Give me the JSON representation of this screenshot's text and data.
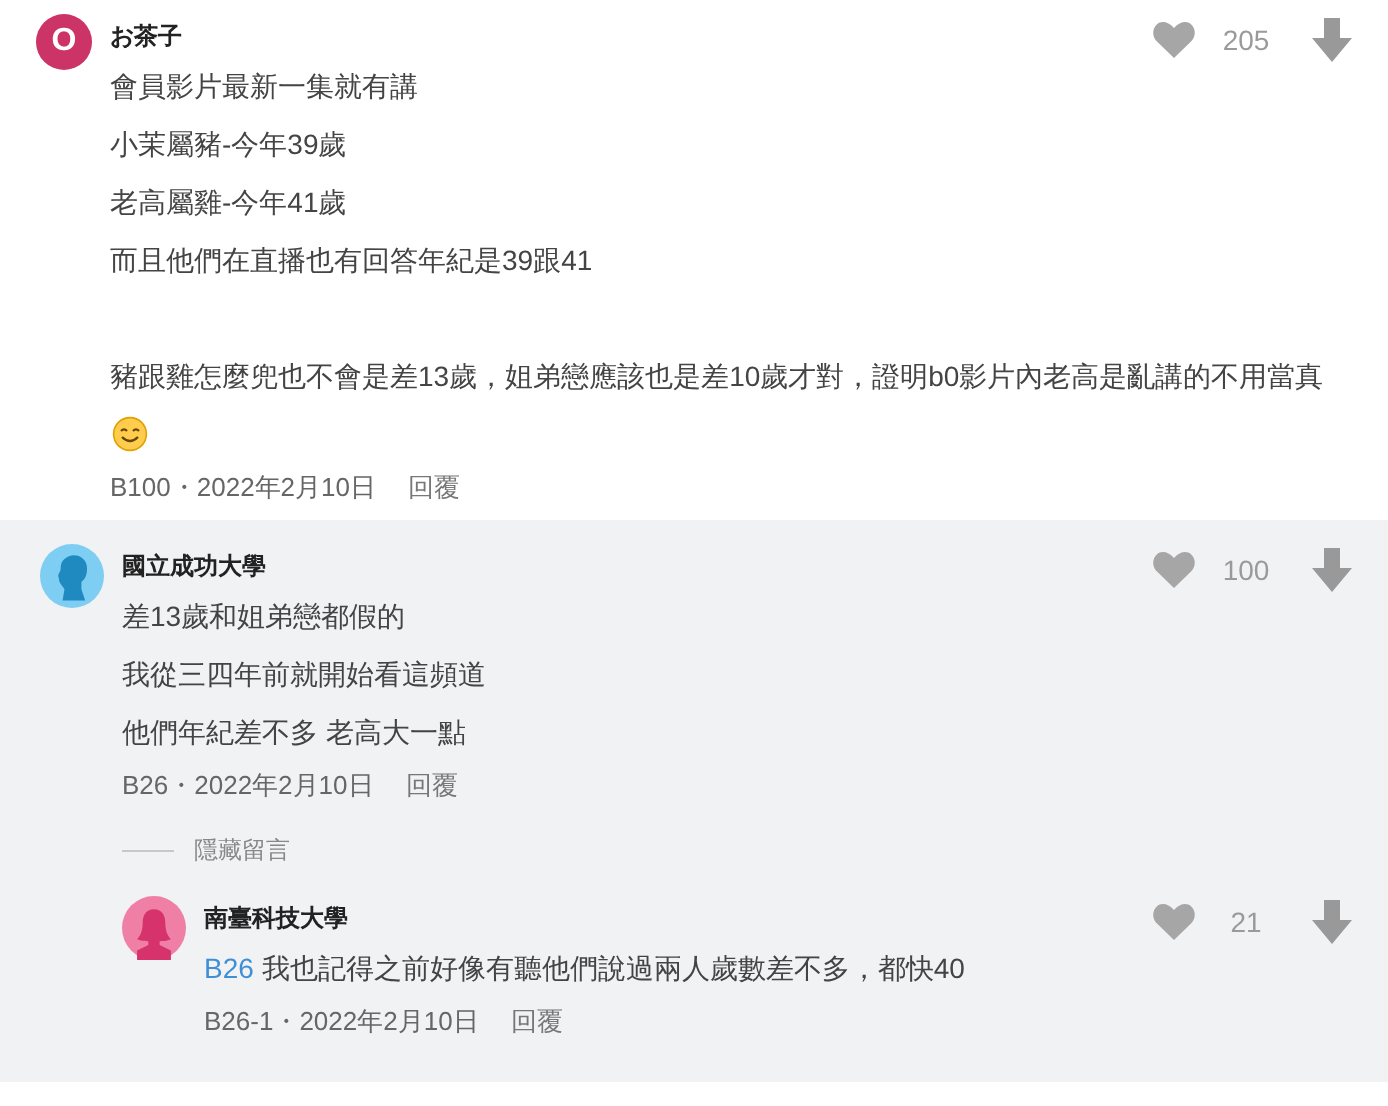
{
  "comments": [
    {
      "author": "お茶子",
      "highlighted": false,
      "avatar": {
        "kind": "letter",
        "letter": "O",
        "color": "#cc3366"
      },
      "paragraphs": [
        [
          "會員影片最新一集就有講",
          "小茉屬豬-今年39歲",
          "老高屬雞-今年41歲",
          "而且他們在直播也有回答年紀是39跟41"
        ],
        [
          "豬跟雞怎麼兜也不會是差13歲，姐弟戀應該也是差10歲才對，證明b0影片內老高是亂講的不用當真"
        ]
      ],
      "smile_emoji": true,
      "likes": "205",
      "floor": "B100",
      "separator": "・",
      "date": "2022年2月10日",
      "reply_label": "回覆"
    },
    {
      "author": "國立成功大學",
      "highlighted": true,
      "avatar": {
        "kind": "male",
        "color": "#7ecdf2"
      },
      "paragraphs": [
        [
          "差13歲和姐弟戀都假的",
          "我從三四年前就開始看這頻道",
          "他們年紀差不多 老高大一點"
        ]
      ],
      "likes": "100",
      "floor": "B26",
      "separator": "・",
      "date": "2022年2月10日",
      "reply_label": "回覆",
      "hide_label": "隱藏留言",
      "children": [
        {
          "author": "南臺科技大學",
          "avatar": {
            "kind": "female",
            "color": "#f07fa6"
          },
          "mention": "B26",
          "text": "我也記得之前好像有聽他們說過兩人歲數差不多，都快40",
          "likes": "21",
          "floor": "B26-1",
          "separator": "・",
          "date": "2022年2月10日",
          "reply_label": "回覆"
        }
      ]
    }
  ]
}
